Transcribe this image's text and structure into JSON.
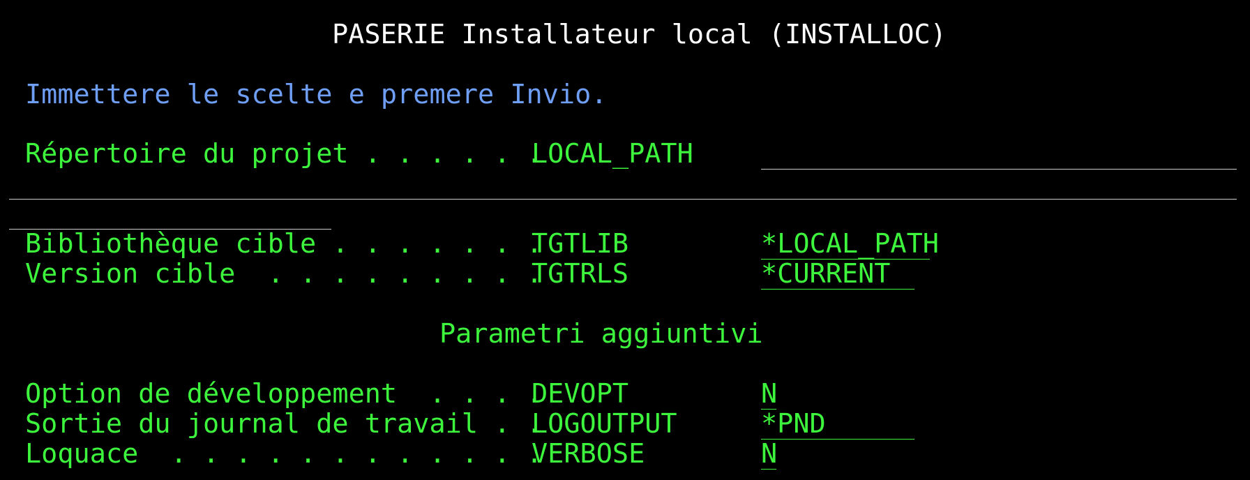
{
  "title": "PASERIE Installateur local (INSTALLOC)",
  "instruction": "Immettere le scelte e premere Invio.",
  "params": [
    {
      "label": "Répertoire du projet . . . . . .",
      "keyword": "LOCAL_PATH",
      "value": ""
    },
    {
      "label": "Bibliothèque cible . . . . . . .",
      "keyword": "TGTLIB",
      "value": "*LOCAL_PATH"
    },
    {
      "label": "Version cible  . . . . . . . . .",
      "keyword": "TGTRLS",
      "value": "*CURRENT"
    }
  ],
  "additional_header": "Parametri aggiuntivi",
  "additional_params": [
    {
      "label": "Option de développement  . . . .",
      "keyword": "DEVOPT",
      "value": "N"
    },
    {
      "label": "Sortie du journal de travail . .",
      "keyword": "LOGOUTPUT",
      "value": "*PND"
    },
    {
      "label": "Loquace  . . . . . . . . . . . .",
      "keyword": "VERBOSE",
      "value": "N"
    }
  ],
  "colors": {
    "background": "#000000",
    "title": "#ffffff",
    "instruction": "#6f9ff5",
    "field_text": "#3df53d"
  }
}
